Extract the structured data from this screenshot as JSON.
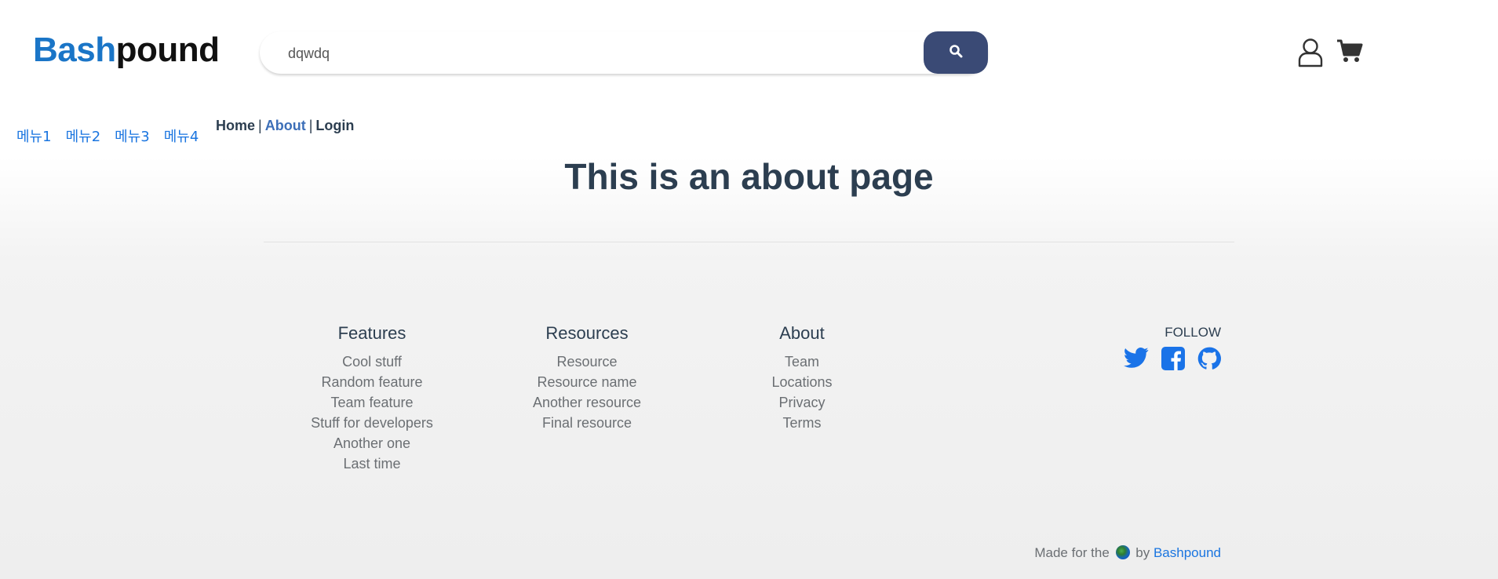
{
  "brand": {
    "part1": "Bash",
    "part2": "pound"
  },
  "search": {
    "value": "dqwdq",
    "button_icon": "search-icon"
  },
  "header_icons": [
    "user-icon",
    "cart-icon"
  ],
  "side_menu": [
    "메뉴1",
    "메뉴2",
    "메뉴3",
    "메뉴4"
  ],
  "nav": {
    "home": "Home",
    "about": "About",
    "login": "Login",
    "separator": "|"
  },
  "page": {
    "title": "This is an about page"
  },
  "footer": {
    "features": {
      "title": "Features",
      "items": [
        "Cool stuff",
        "Random feature",
        "Team feature",
        "Stuff for developers",
        "Another one",
        "Last time"
      ]
    },
    "resources": {
      "title": "Resources",
      "items": [
        "Resource",
        "Resource name",
        "Another resource",
        "Final resource"
      ]
    },
    "about": {
      "title": "About",
      "items": [
        "Team",
        "Locations",
        "Privacy",
        "Terms"
      ]
    },
    "follow": {
      "label": "FOLLOW",
      "icons": [
        "twitter-icon",
        "facebook-icon",
        "github-icon"
      ]
    },
    "made": {
      "prefix": "Made for the",
      "by": "by",
      "link": "Bashpound"
    }
  },
  "colors": {
    "brand_blue": "#1a75c7",
    "search_button": "#3a4a75",
    "link_blue": "#1a75e0",
    "active_nav": "#3d6fb8",
    "text_dark": "#2c3e50"
  }
}
